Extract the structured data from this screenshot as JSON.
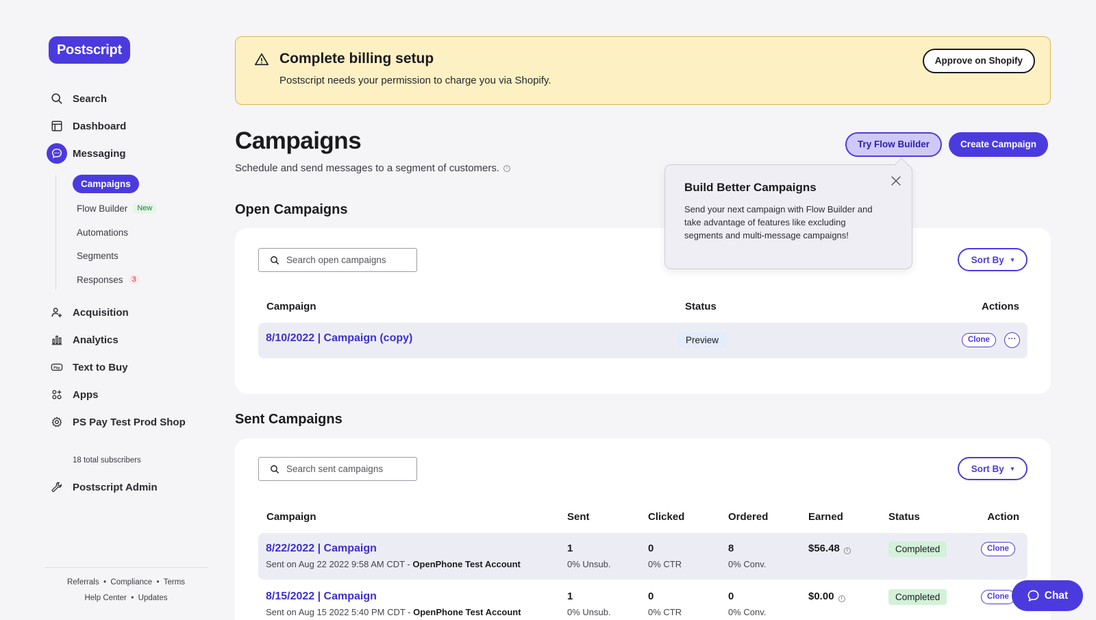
{
  "brand": {
    "name": "Postscript",
    "accent": "#4b3bdf"
  },
  "nav": {
    "search": "Search",
    "dashboard": "Dashboard",
    "messaging": "Messaging",
    "sub": {
      "campaigns": "Campaigns",
      "flow_builder": "Flow Builder",
      "flow_builder_badge": "New",
      "automations": "Automations",
      "segments": "Segments",
      "responses": "Responses",
      "responses_count": "3"
    },
    "acquisition": "Acquisition",
    "analytics": "Analytics",
    "text_to_buy": "Text to Buy",
    "apps": "Apps",
    "shop": "PS Pay Test Prod Shop",
    "subscribers": "18 total subscribers",
    "admin": "Postscript Admin",
    "footer_row1": [
      "Referrals",
      "Compliance",
      "Terms"
    ],
    "footer_row2": [
      "Help Center",
      "Updates"
    ],
    "footer_sep": "•"
  },
  "banner": {
    "title": "Complete billing setup",
    "description": "Postscript needs your permission to charge you via Shopify.",
    "button": "Approve on Shopify"
  },
  "page": {
    "title": "Campaigns",
    "subtitle": "Schedule and send messages to a segment of customers.",
    "try_flow_builder": "Try Flow Builder",
    "create_campaign": "Create Campaign"
  },
  "popover": {
    "title": "Build Better Campaigns",
    "body": "Send your next campaign with Flow Builder and take advantage of features like excluding segments and multi-message campaigns!"
  },
  "open_campaigns": {
    "title": "Open Campaigns",
    "search_placeholder": "Search open campaigns",
    "sort": "Sort By",
    "headers": {
      "campaign": "Campaign",
      "status": "Status",
      "actions": "Actions"
    },
    "rows": [
      {
        "name": "8/10/2022 | Campaign (copy)",
        "status": "Preview",
        "clone": "Clone",
        "more": "···"
      }
    ]
  },
  "sent_campaigns": {
    "title": "Sent Campaigns",
    "search_placeholder": "Search sent campaigns",
    "sort": "Sort By",
    "headers": {
      "campaign": "Campaign",
      "sent": "Sent",
      "clicked": "Clicked",
      "ordered": "Ordered",
      "earned": "Earned",
      "status": "Status",
      "action": "Action"
    },
    "rows": [
      {
        "name": "8/22/2022 | Campaign",
        "sent_on": "Sent on Aug 22 2022 9:58 AM CDT - ",
        "account": "OpenPhone Test Account",
        "sent": "1",
        "unsub": "0% Unsub.",
        "clicked": "0",
        "ctr": "0% CTR",
        "ordered": "8",
        "conv": "0% Conv.",
        "earned": "$56.48",
        "status": "Completed",
        "clone": "Clone"
      },
      {
        "name": "8/15/2022 | Campaign",
        "sent_on": "Sent on Aug 15 2022 5:40 PM CDT - ",
        "account": "OpenPhone Test Account",
        "sent": "1",
        "unsub": "0% Unsub.",
        "clicked": "0",
        "ctr": "0% CTR",
        "ordered": "0",
        "conv": "0% Conv.",
        "earned": "$0.00",
        "status": "Completed",
        "clone": "Clone"
      }
    ]
  },
  "chat": {
    "label": "Chat"
  }
}
